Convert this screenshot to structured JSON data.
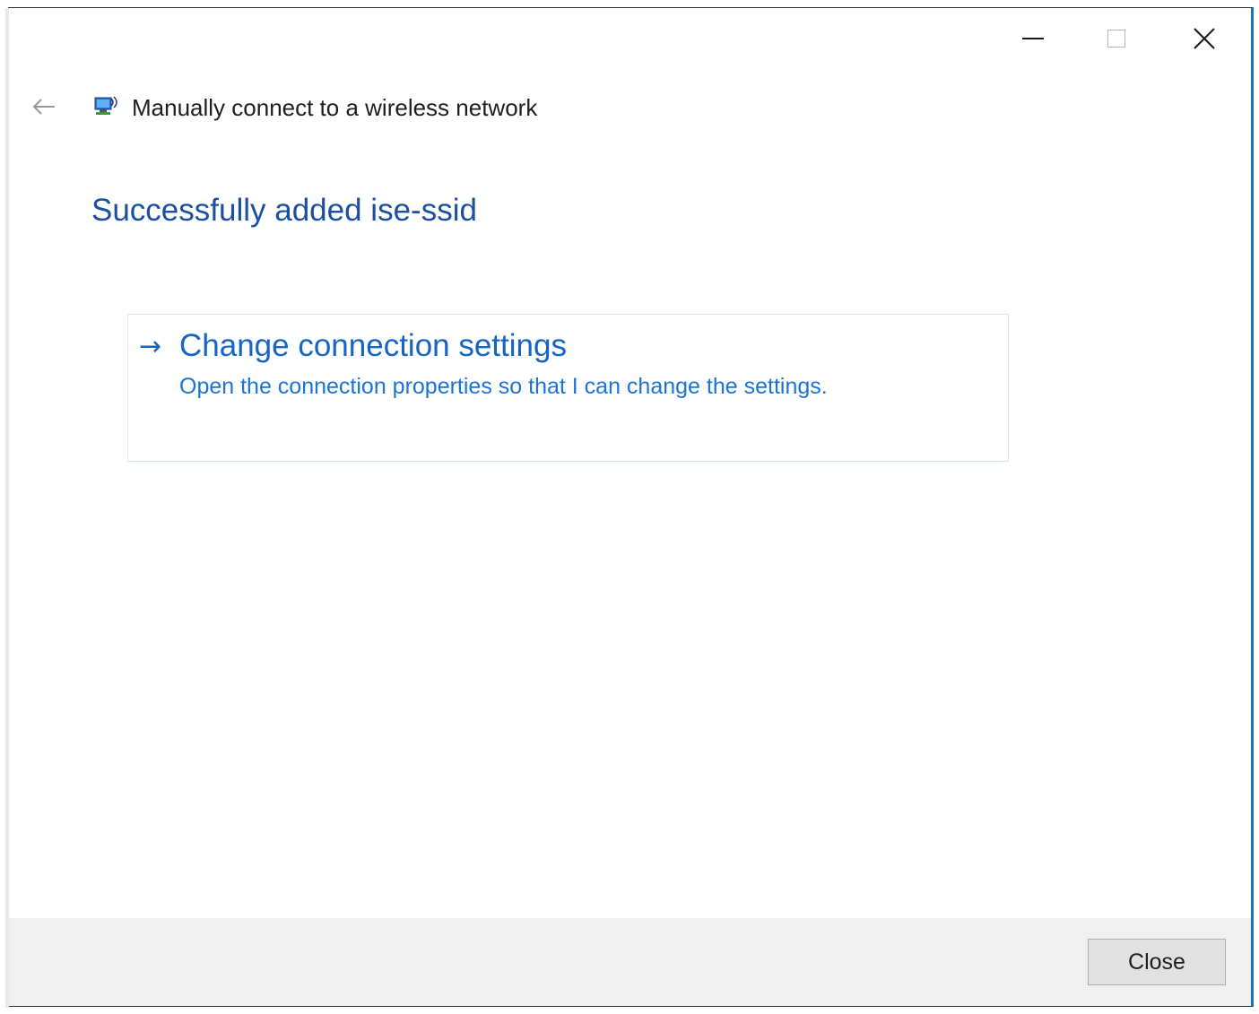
{
  "window": {
    "title": "Manually connect to a wireless network",
    "caption_buttons": {
      "minimize_icon": "minimize-icon",
      "maximize_icon": "maximize-icon",
      "close_icon": "close-icon"
    }
  },
  "header": {
    "back_icon": "back-arrow-icon",
    "app_icon": "wireless-network-icon"
  },
  "main": {
    "heading": "Successfully added ise-ssid",
    "command_link": {
      "arrow": "→",
      "title": "Change connection settings",
      "description": "Open the connection properties so that I can change the settings."
    }
  },
  "footer": {
    "close_label": "Close"
  },
  "colors": {
    "heading": "#1b4fa3",
    "link": "#1664c4",
    "footer_bg": "#f0f0f0",
    "accent_border": "#1c6fc4"
  }
}
